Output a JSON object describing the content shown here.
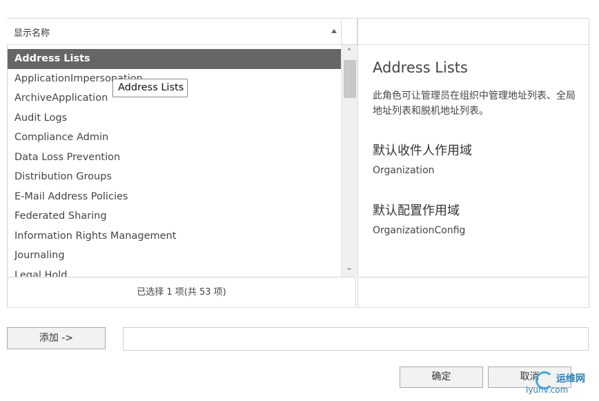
{
  "header": {
    "column_label": "显示名称"
  },
  "list": {
    "items": [
      {
        "label": "Address Lists",
        "selected": true
      },
      {
        "label": "ApplicationImpersonation",
        "selected": false
      },
      {
        "label": "ArchiveApplication",
        "selected": false
      },
      {
        "label": "Audit Logs",
        "selected": false
      },
      {
        "label": "Compliance Admin",
        "selected": false
      },
      {
        "label": "Data Loss Prevention",
        "selected": false
      },
      {
        "label": "Distribution Groups",
        "selected": false
      },
      {
        "label": "E-Mail Address Policies",
        "selected": false
      },
      {
        "label": "Federated Sharing",
        "selected": false
      },
      {
        "label": "Information Rights Management",
        "selected": false
      },
      {
        "label": "Journaling",
        "selected": false
      },
      {
        "label": "Legal Hold",
        "selected": false
      }
    ],
    "tooltip": "Address Lists",
    "status": "已选择 1 项(共 53 项)"
  },
  "details": {
    "title": "Address Lists",
    "description": "此角色可让管理员在组织中管理地址列表、全局地址列表和脱机地址列表。",
    "recipient_scope_heading": "默认收件人作用域",
    "recipient_scope_value": "Organization",
    "config_scope_heading": "默认配置作用域",
    "config_scope_value": "OrganizationConfig"
  },
  "actions": {
    "add_label": "添加 ->",
    "add_field_value": "",
    "ok_label": "确定",
    "cancel_label": "取消"
  },
  "watermark": {
    "name": "运维网",
    "url": "iyunv.com"
  },
  "colors": {
    "selected_row": "#666666",
    "border": "#d7d7d7",
    "watermark": "#2a7fb8"
  }
}
